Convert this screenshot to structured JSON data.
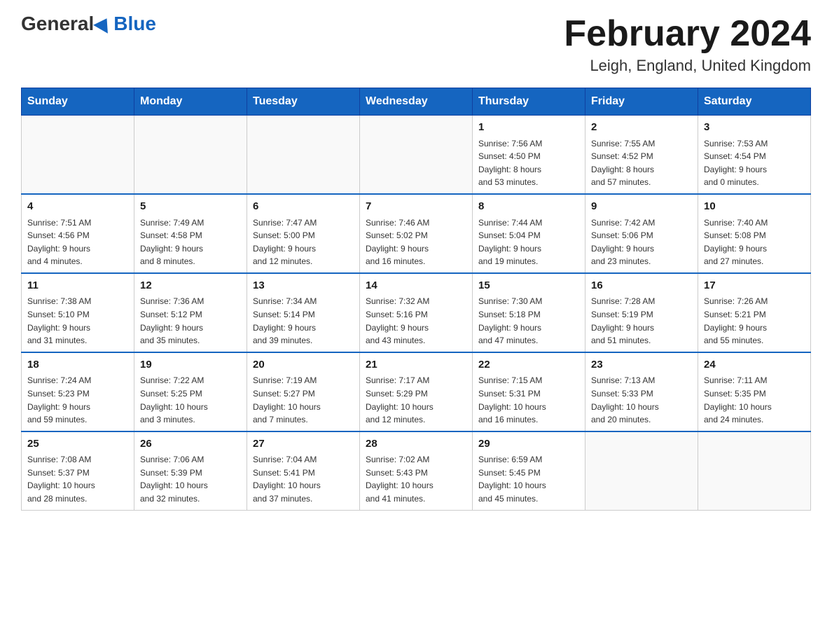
{
  "header": {
    "logo_general": "General",
    "logo_blue": "Blue",
    "title": "February 2024",
    "subtitle": "Leigh, England, United Kingdom"
  },
  "days_of_week": [
    "Sunday",
    "Monday",
    "Tuesday",
    "Wednesday",
    "Thursday",
    "Friday",
    "Saturday"
  ],
  "weeks": [
    {
      "days": [
        {
          "number": "",
          "info": ""
        },
        {
          "number": "",
          "info": ""
        },
        {
          "number": "",
          "info": ""
        },
        {
          "number": "",
          "info": ""
        },
        {
          "number": "1",
          "info": "Sunrise: 7:56 AM\nSunset: 4:50 PM\nDaylight: 8 hours\nand 53 minutes."
        },
        {
          "number": "2",
          "info": "Sunrise: 7:55 AM\nSunset: 4:52 PM\nDaylight: 8 hours\nand 57 minutes."
        },
        {
          "number": "3",
          "info": "Sunrise: 7:53 AM\nSunset: 4:54 PM\nDaylight: 9 hours\nand 0 minutes."
        }
      ]
    },
    {
      "days": [
        {
          "number": "4",
          "info": "Sunrise: 7:51 AM\nSunset: 4:56 PM\nDaylight: 9 hours\nand 4 minutes."
        },
        {
          "number": "5",
          "info": "Sunrise: 7:49 AM\nSunset: 4:58 PM\nDaylight: 9 hours\nand 8 minutes."
        },
        {
          "number": "6",
          "info": "Sunrise: 7:47 AM\nSunset: 5:00 PM\nDaylight: 9 hours\nand 12 minutes."
        },
        {
          "number": "7",
          "info": "Sunrise: 7:46 AM\nSunset: 5:02 PM\nDaylight: 9 hours\nand 16 minutes."
        },
        {
          "number": "8",
          "info": "Sunrise: 7:44 AM\nSunset: 5:04 PM\nDaylight: 9 hours\nand 19 minutes."
        },
        {
          "number": "9",
          "info": "Sunrise: 7:42 AM\nSunset: 5:06 PM\nDaylight: 9 hours\nand 23 minutes."
        },
        {
          "number": "10",
          "info": "Sunrise: 7:40 AM\nSunset: 5:08 PM\nDaylight: 9 hours\nand 27 minutes."
        }
      ]
    },
    {
      "days": [
        {
          "number": "11",
          "info": "Sunrise: 7:38 AM\nSunset: 5:10 PM\nDaylight: 9 hours\nand 31 minutes."
        },
        {
          "number": "12",
          "info": "Sunrise: 7:36 AM\nSunset: 5:12 PM\nDaylight: 9 hours\nand 35 minutes."
        },
        {
          "number": "13",
          "info": "Sunrise: 7:34 AM\nSunset: 5:14 PM\nDaylight: 9 hours\nand 39 minutes."
        },
        {
          "number": "14",
          "info": "Sunrise: 7:32 AM\nSunset: 5:16 PM\nDaylight: 9 hours\nand 43 minutes."
        },
        {
          "number": "15",
          "info": "Sunrise: 7:30 AM\nSunset: 5:18 PM\nDaylight: 9 hours\nand 47 minutes."
        },
        {
          "number": "16",
          "info": "Sunrise: 7:28 AM\nSunset: 5:19 PM\nDaylight: 9 hours\nand 51 minutes."
        },
        {
          "number": "17",
          "info": "Sunrise: 7:26 AM\nSunset: 5:21 PM\nDaylight: 9 hours\nand 55 minutes."
        }
      ]
    },
    {
      "days": [
        {
          "number": "18",
          "info": "Sunrise: 7:24 AM\nSunset: 5:23 PM\nDaylight: 9 hours\nand 59 minutes."
        },
        {
          "number": "19",
          "info": "Sunrise: 7:22 AM\nSunset: 5:25 PM\nDaylight: 10 hours\nand 3 minutes."
        },
        {
          "number": "20",
          "info": "Sunrise: 7:19 AM\nSunset: 5:27 PM\nDaylight: 10 hours\nand 7 minutes."
        },
        {
          "number": "21",
          "info": "Sunrise: 7:17 AM\nSunset: 5:29 PM\nDaylight: 10 hours\nand 12 minutes."
        },
        {
          "number": "22",
          "info": "Sunrise: 7:15 AM\nSunset: 5:31 PM\nDaylight: 10 hours\nand 16 minutes."
        },
        {
          "number": "23",
          "info": "Sunrise: 7:13 AM\nSunset: 5:33 PM\nDaylight: 10 hours\nand 20 minutes."
        },
        {
          "number": "24",
          "info": "Sunrise: 7:11 AM\nSunset: 5:35 PM\nDaylight: 10 hours\nand 24 minutes."
        }
      ]
    },
    {
      "days": [
        {
          "number": "25",
          "info": "Sunrise: 7:08 AM\nSunset: 5:37 PM\nDaylight: 10 hours\nand 28 minutes."
        },
        {
          "number": "26",
          "info": "Sunrise: 7:06 AM\nSunset: 5:39 PM\nDaylight: 10 hours\nand 32 minutes."
        },
        {
          "number": "27",
          "info": "Sunrise: 7:04 AM\nSunset: 5:41 PM\nDaylight: 10 hours\nand 37 minutes."
        },
        {
          "number": "28",
          "info": "Sunrise: 7:02 AM\nSunset: 5:43 PM\nDaylight: 10 hours\nand 41 minutes."
        },
        {
          "number": "29",
          "info": "Sunrise: 6:59 AM\nSunset: 5:45 PM\nDaylight: 10 hours\nand 45 minutes."
        },
        {
          "number": "",
          "info": ""
        },
        {
          "number": "",
          "info": ""
        }
      ]
    }
  ]
}
